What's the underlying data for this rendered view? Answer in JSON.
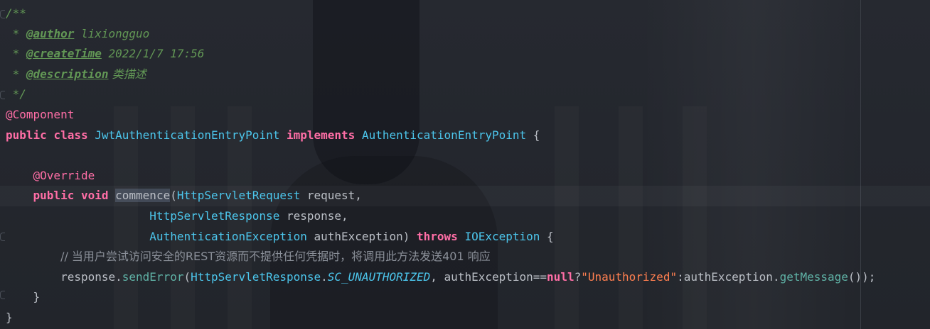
{
  "lines": [
    {
      "doc_open": "/**"
    },
    {
      "prefix": " * ",
      "tag": "@author",
      "value": " lixiongguo"
    },
    {
      "prefix": " * ",
      "tag": "@createTime",
      "value": " 2022/1/7 17:56"
    },
    {
      "prefix": " * ",
      "tag": "@description",
      "value": " 类描述"
    },
    {
      "doc_close": " */"
    },
    {
      "annotation": "@Component"
    },
    {
      "kw1": "public",
      "kw2": "class",
      "class_name": "JwtAuthenticationEntryPoint",
      "kw3": "implements",
      "interface_name": "AuthenticationEntryPoint",
      "brace": "{"
    },
    {},
    {
      "annotation": "@Override"
    },
    {
      "kw1": "public",
      "kw2": "void",
      "method": "commence",
      "paren": "(",
      "type": "HttpServletRequest",
      "param": " request,"
    },
    {
      "type": "HttpServletResponse",
      "param": " response,"
    },
    {
      "type": "AuthenticationException",
      "param": " authException)",
      "kw": "throws",
      "exception": "IOException",
      "brace": "{"
    },
    {
      "comment": "// 当用户尝试访问安全的REST资源而不提供任何凭据时，将调用此方法发送401 响应"
    },
    {
      "obj": "response",
      "dot": ".",
      "method": "sendError",
      "paren": "(",
      "class_ref": "HttpServletResponse",
      "dot2": ".",
      "constant": "SC_UNAUTHORIZED",
      "sep": ", authException==",
      "null_kw": "null",
      "q": "?",
      "string": "\"Unauthorized\"",
      "rest": ":authException.",
      "method2": "getMessage",
      "end": "());"
    },
    {
      "close": "}"
    },
    {
      "close": "}"
    }
  ]
}
